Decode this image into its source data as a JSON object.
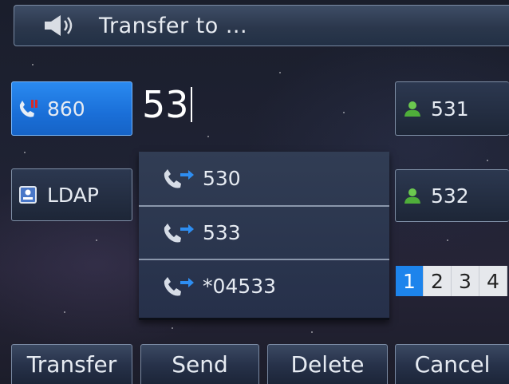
{
  "title": "Transfer to ...",
  "dial_input": "53",
  "line_keys_left": [
    {
      "label": "860",
      "icon": "missed-call-icon",
      "active": true
    },
    {
      "label": "LDAP",
      "icon": "directory-book-icon",
      "active": false
    }
  ],
  "line_keys_right": [
    {
      "label": "531",
      "icon": "contact-person-icon"
    },
    {
      "label": "532",
      "icon": "contact-person-icon"
    }
  ],
  "suggestions": [
    {
      "label": "530",
      "icon": "dialed-call-icon"
    },
    {
      "label": "533",
      "icon": "dialed-call-icon"
    },
    {
      "label": "*04533",
      "icon": "dialed-call-icon"
    }
  ],
  "pager": {
    "pages": [
      "1",
      "2",
      "3",
      "4"
    ],
    "current": "1"
  },
  "softkeys": [
    "Transfer",
    "Send",
    "Delete",
    "Cancel"
  ],
  "colors": {
    "accent": "#1d84ec",
    "missed": "#d42a2a",
    "contact": "#5fc24a"
  }
}
